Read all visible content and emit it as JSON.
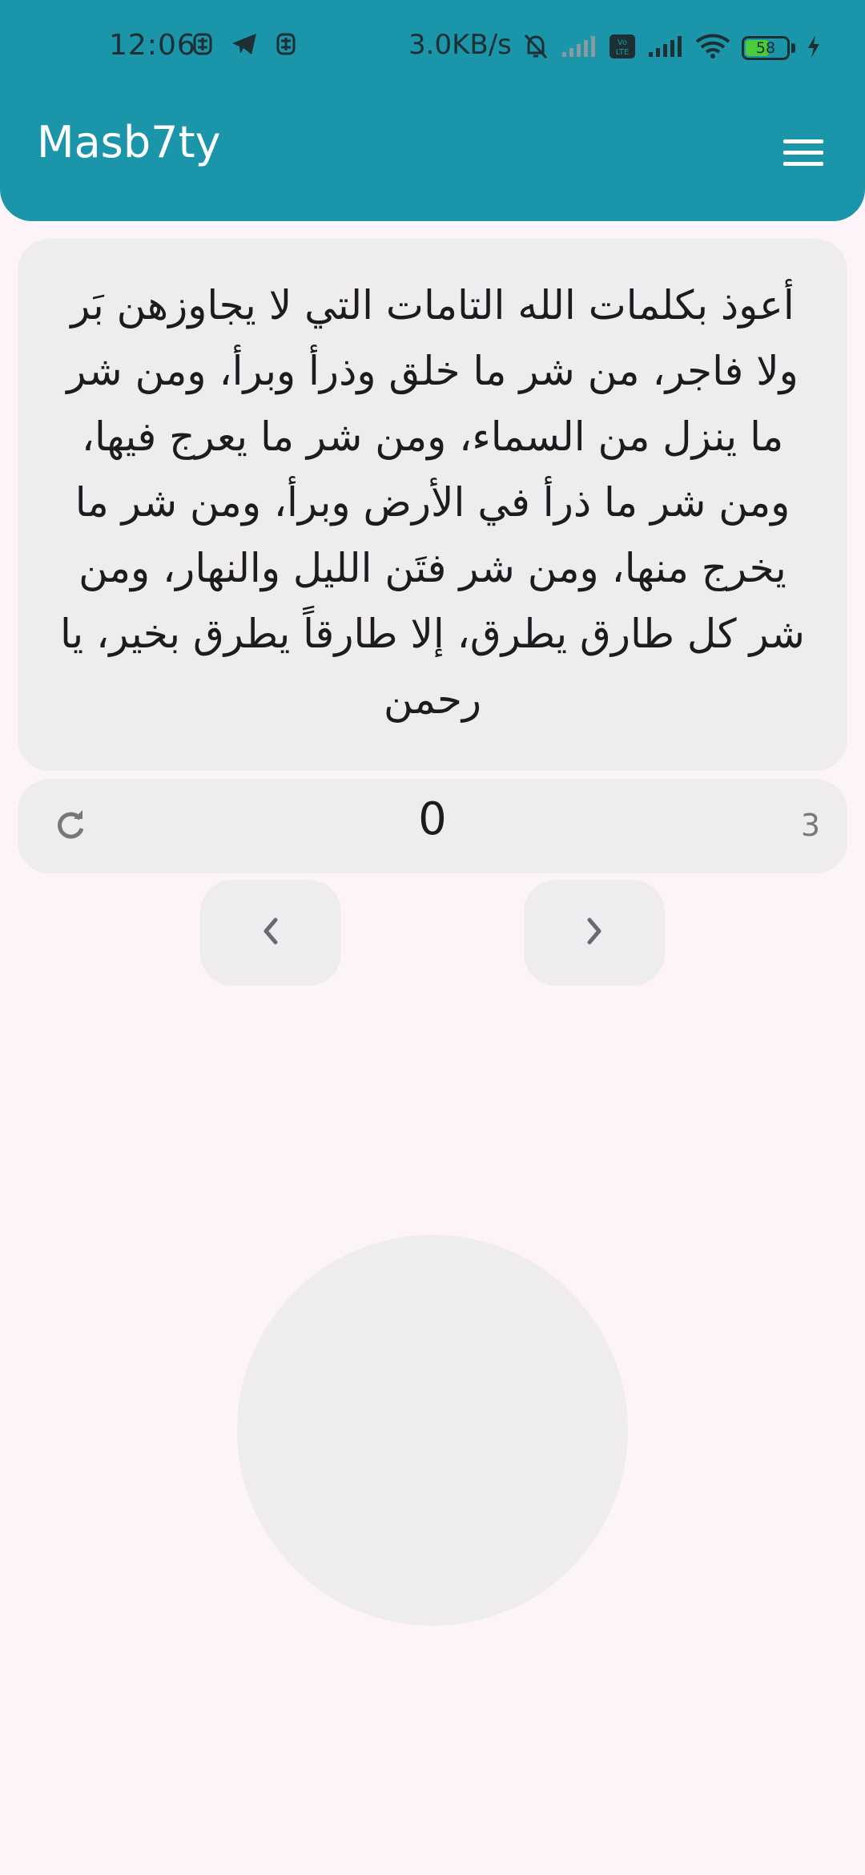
{
  "status_bar": {
    "time": "12:06",
    "network_speed": "3.0KB/s",
    "battery_level": "58",
    "battery_fraction": 0.58,
    "left_icons": [
      "notification-app-icon",
      "telegram-icon",
      "notification-app-icon"
    ],
    "right_icons": [
      "bell-muted-icon",
      "signal-icon",
      "volte-icon",
      "signal-icon",
      "wifi-icon",
      "battery-icon",
      "charging-icon"
    ],
    "volte_label": "Vo LTE"
  },
  "app_bar": {
    "title": "Masb7ty",
    "menu_icon": "hamburger-menu-icon"
  },
  "dhikr": {
    "text": "أعوذ بكلمات الله التامات التي لا يجاوزهن بَر ولا فاجر، من شر ما خلق وذرأ وبرأ، ومن شر ما ينزل من السماء، ومن شر ما يعرج فيها، ومن شر ما ذرأ في الأرض وبرأ، ومن شر ما يخرج منها، ومن شر فتَن الليل والنهار، ومن شر كل طارق يطرق، إلا طارقاً يطرق بخير، يا رحمن"
  },
  "counter": {
    "value": "0",
    "target": "3",
    "reset_icon": "refresh-icon"
  },
  "navigation": {
    "prev_icon": "chevron-left-icon",
    "next_icon": "chevron-right-icon"
  },
  "colors": {
    "app_bar": "#1a95aa",
    "background": "#fdf4fa",
    "card": "#efecef",
    "text": "#1d1b1e",
    "muted_text": "#7a777b"
  }
}
